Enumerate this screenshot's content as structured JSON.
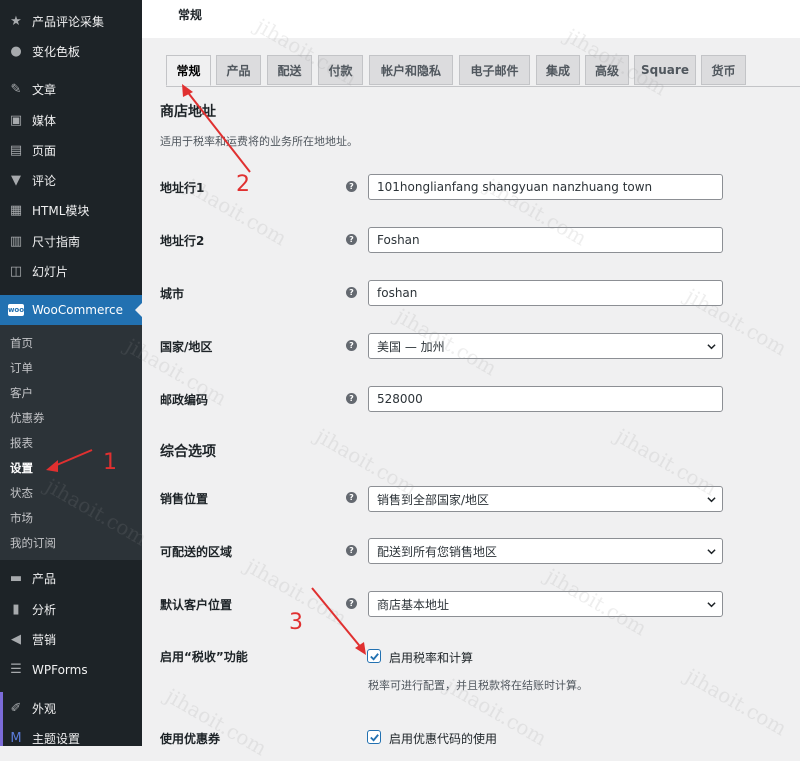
{
  "sidebar": {
    "items_top": [
      {
        "icon": "star-icon",
        "label": "产品评论采集"
      },
      {
        "icon": "swatches-icon",
        "label": "变化色板"
      }
    ],
    "items_content": [
      {
        "icon": "pin-icon",
        "label": "文章"
      },
      {
        "icon": "media-icon",
        "label": "媒体"
      },
      {
        "icon": "page-icon",
        "label": "页面"
      },
      {
        "icon": "comment-icon",
        "label": "评论"
      },
      {
        "icon": "grid-icon",
        "label": "HTML模块"
      },
      {
        "icon": "table-icon",
        "label": "尺寸指南"
      },
      {
        "icon": "slides-icon",
        "label": "幻灯片"
      }
    ],
    "woocommerce_label": "WooCommerce",
    "woo_logo_text": "woo",
    "submenu": [
      "首页",
      "订单",
      "客户",
      "优惠券",
      "报表",
      "设置",
      "状态",
      "市场",
      "我的订阅"
    ],
    "items_bottom": [
      {
        "icon": "archive-icon",
        "label": "产品"
      },
      {
        "icon": "chart-icon",
        "label": "分析"
      },
      {
        "icon": "megaphone-icon",
        "label": "营销"
      },
      {
        "icon": "forms-icon",
        "label": "WPForms"
      }
    ],
    "items_end": [
      {
        "icon": "brush-icon",
        "label": "外观"
      },
      {
        "icon": "theme-icon",
        "label": "主题设置"
      }
    ]
  },
  "header": {
    "title": "常规"
  },
  "tabs": [
    "常规",
    "产品",
    "配送",
    "付款",
    "帐户和隐私",
    "电子邮件",
    "集成",
    "高级",
    "Square",
    "货币"
  ],
  "store_address": {
    "title": "商店地址",
    "description": "适用于税率和运费将的业务所在地地址。",
    "fields": [
      {
        "label": "地址行1",
        "value": "101honglianfang shangyuan nanzhuang town",
        "type": "text"
      },
      {
        "label": "地址行2",
        "value": "Foshan",
        "type": "text"
      },
      {
        "label": "城市",
        "value": "foshan",
        "type": "text"
      },
      {
        "label": "国家/地区",
        "value": "美国 — 加州",
        "type": "select"
      },
      {
        "label": "邮政编码",
        "value": "528000",
        "type": "text"
      }
    ]
  },
  "general_options": {
    "title": "综合选项",
    "fields": [
      {
        "label": "销售位置",
        "value": "销售到全部国家/地区",
        "type": "select"
      },
      {
        "label": "可配送的区域",
        "value": "配送到所有您销售地区",
        "type": "select"
      },
      {
        "label": "默认客户位置",
        "value": "商店基本地址",
        "type": "select"
      }
    ],
    "tax": {
      "label": "启用“税收”功能",
      "checkbox_label": "启用税率和计算",
      "checked": true,
      "description": "税率可进行配置，并且税款将在结账时计算。"
    },
    "coupons": {
      "label": "使用优惠券",
      "checkbox_label": "启用优惠代码的使用",
      "checked": true
    }
  },
  "help_glyph": "?",
  "annotations": [
    "1",
    "2",
    "3"
  ],
  "watermark": "jihaoit.com",
  "colors": {
    "sidebar_bg": "#1d2327",
    "accent": "#2271b1",
    "annotation": "#e03030"
  }
}
